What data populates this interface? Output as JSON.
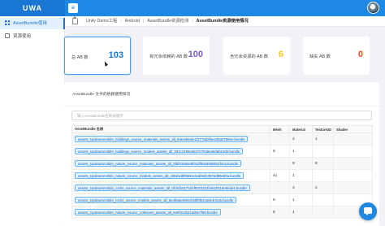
{
  "app": {
    "logo": "UWA"
  },
  "sidebar": {
    "items": [
      {
        "label": "AssetBundle使用",
        "icon": "grid-icon",
        "active": true
      },
      {
        "label": "资源使用",
        "icon": "list-icon",
        "active": false
      }
    ]
  },
  "breadcrumb": [
    "Unity Demo工程",
    "Android",
    "AssetBundle资源检测",
    "AssetBundle资源使用情况"
  ],
  "cards": [
    {
      "label": "总 AB 数",
      "value": "103",
      "color": "#1976d2",
      "selected": true
    },
    {
      "label": "有冗余依赖的 AB 数",
      "value": "100",
      "color": "#7e57c2",
      "selected": false
    },
    {
      "label": "含冗余资源的 AB 数",
      "value": "6",
      "color": "#fbc02d",
      "selected": false
    },
    {
      "label": "缺失 AB 数",
      "value": "0",
      "color": "#f4511e",
      "selected": false
    }
  ],
  "panel": {
    "title": "AssetBundle 文件的依赖使用情况",
    "search_placeholder": "输入AssetBundle名称关键字",
    "columns": [
      "AssetBundle 名称",
      "Mesh",
      "Material",
      "Texture2D",
      "Shader"
    ],
    "rows": [
      {
        "name": "assets_topdownmobile_buildings_source_materials_assets_all_8de4d6a2e1f2778d2f6ee35a0758ee.bundle",
        "mesh": "",
        "material": "2",
        "texture": "1",
        "shader": ""
      },
      {
        "name": "assets_topdownmobile_buildings_source_models_assets_all_291c2495e654727948ea6d5be3d0.bundle",
        "mesh": "8",
        "material": "1",
        "texture": "",
        "shader": ""
      },
      {
        "name": "assets_topdownmobile_nature_source_materials_assets_all_0faf51650e9f01df60a3089921f2e3.bundle",
        "mesh": "",
        "material": "9",
        "texture": "8",
        "shader": ""
      },
      {
        "name": "assets_topdownmobile_nature_source_models_assets_all_c5523dbf950013cd06d1357ad99e80a.bundle",
        "mesh": "41",
        "material": "1",
        "texture": "",
        "shader": ""
      },
      {
        "name": "assets_topdownmobile_rocks_source_materials_assets_all_0fc8d18171d1f6323221b4618119e8ede4.bundle",
        "mesh": "",
        "material": "3",
        "texture": "2",
        "shader": ""
      },
      {
        "name": "assets_topdownmobile_rocks_source_models_assets_all_5e4b5ae9c8e23d9f3b2ca8e441a5.bundle",
        "mesh": "5",
        "material": "1",
        "texture": "",
        "shader": ""
      },
      {
        "name": "assets_topdownmobile_nature_source_collisions_assets_all_6e8f4c3b21ad0e7f99.bundle",
        "mesh": "8",
        "material": "1",
        "texture": "",
        "shader": ""
      }
    ]
  }
}
